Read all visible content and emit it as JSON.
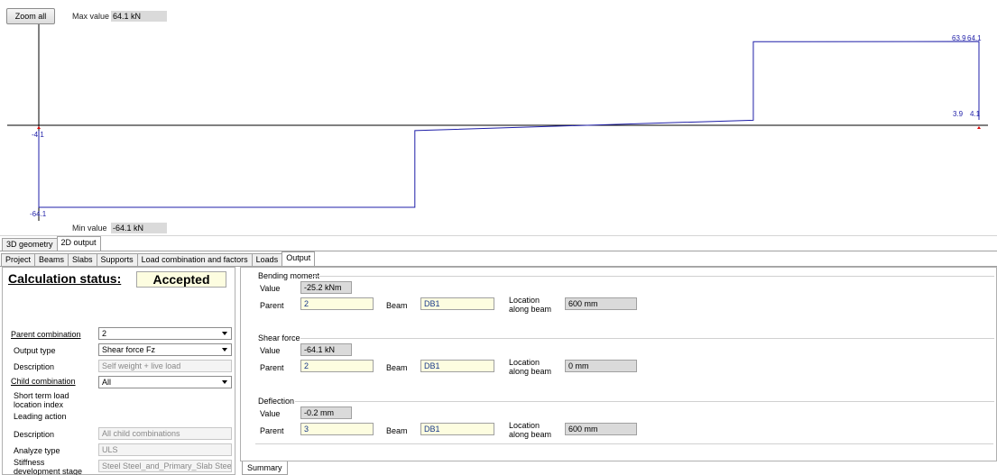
{
  "chart_panel": {
    "zoom_label": "Zoom all",
    "max_label": "Max value",
    "max_value": "64.1 kN",
    "min_label": "Min value",
    "min_value": "-64.1 kN"
  },
  "chart_data": {
    "type": "line",
    "title": "",
    "xlabel": "",
    "ylabel": "",
    "x": [
      0,
      0,
      0.4,
      0.4,
      0.76,
      0.76,
      1.0,
      1.0
    ],
    "y": [
      -4.1,
      -64.1,
      -64.1,
      -4.1,
      3.9,
      63.9,
      64.1,
      4.1
    ],
    "annotations": [
      "-4.1",
      "-64.1",
      "63.9",
      "64.1",
      "3.9",
      "4.1"
    ],
    "ylim": [
      -64.1,
      64.1
    ],
    "grid": false,
    "line_color": "#1f1fa8"
  },
  "view_tabs": [
    "3D geometry",
    "2D output"
  ],
  "main_tabs": [
    "Project",
    "Beams",
    "Slabs",
    "Supports",
    "Load combination and factors",
    "Loads",
    "Output"
  ],
  "left": {
    "calc_status_label": "Calculation status:",
    "calc_status_value": "Accepted",
    "parent_combination_label": "Parent combination",
    "parent_combination_value": "2",
    "output_type_label": "Output type",
    "output_type_value": "Shear force Fz",
    "description_label": "Description",
    "description_value": "Self weight + live load",
    "child_combination_label": "Child combination",
    "child_combination_value": "All",
    "short_term_label_1": "Short term load",
    "short_term_label_2": "location index",
    "leading_action_label": "Leading action",
    "description2_label": "Description",
    "description2_value": "All child combinations",
    "analyze_type_label": "Analyze type",
    "analyze_type_value": "ULS",
    "stiffness_label_1": "Stiffness",
    "stiffness_label_2": "development stage",
    "stiffness_value": "Steel Steel_and_Primary_Slab Steel_"
  },
  "right": {
    "groups": [
      {
        "title": "Bending moment",
        "value": "-25.2 kNm",
        "parent": "2",
        "beam": "DB1",
        "location": "600 mm"
      },
      {
        "title": "Shear force",
        "value": "-64.1 kN",
        "parent": "2",
        "beam": "DB1",
        "location": "0 mm"
      },
      {
        "title": "Deflection",
        "value": "-0.2 mm",
        "parent": "3",
        "beam": "DB1",
        "location": "600 mm"
      }
    ],
    "value_label": "Value",
    "parent_label": "Parent",
    "beam_label": "Beam",
    "location_label_1": "Location",
    "location_label_2": "along beam",
    "summary_tab": "Summary"
  },
  "colors": {
    "accent_line": "#1f1fa8",
    "field_yellow": "#fdfde0",
    "field_gray": "#dadada"
  }
}
